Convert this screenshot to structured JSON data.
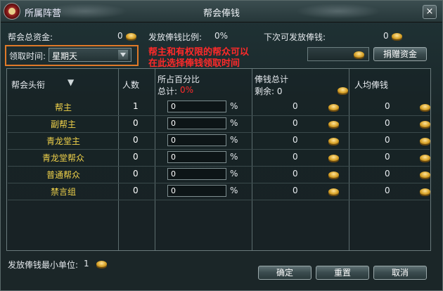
{
  "titlebar": {
    "faction": "所属阵营",
    "title": "帮会俸钱",
    "close": "×"
  },
  "top": {
    "total_funds_label": "帮会总资金:",
    "total_funds_value": "0",
    "ratio_label": "发放俸钱比例:",
    "ratio_value": "0%",
    "next_label": "下次可发放俸钱:",
    "next_value": "0"
  },
  "claim": {
    "label": "领取时间:",
    "value": "星期天"
  },
  "annotation": {
    "line1": "帮主和有权限的帮众可以",
    "line2": "在此选择俸钱领取时间"
  },
  "donate_button": "捐赠资金",
  "table": {
    "headers": {
      "rank": "帮会头衔",
      "count": "人数",
      "percent": "所占百分比",
      "total_label": "总计:",
      "total_value": "0%",
      "salary": "俸钱总计",
      "remaining": "剩余: 0",
      "avg": "人均俸钱"
    },
    "rows": [
      {
        "rank": "帮主",
        "count": "1",
        "pct": "0",
        "salary": "0",
        "avg": "0"
      },
      {
        "rank": "副帮主",
        "count": "0",
        "pct": "0",
        "salary": "0",
        "avg": "0"
      },
      {
        "rank": "青龙堂主",
        "count": "0",
        "pct": "0",
        "salary": "0",
        "avg": "0"
      },
      {
        "rank": "青龙堂帮众",
        "count": "0",
        "pct": "0",
        "salary": "0",
        "avg": "0"
      },
      {
        "rank": "普通帮众",
        "count": "0",
        "pct": "0",
        "salary": "0",
        "avg": "0"
      },
      {
        "rank": "禁言组",
        "count": "0",
        "pct": "0",
        "salary": "0",
        "avg": "0"
      }
    ],
    "percent_sign": "%"
  },
  "bottom": {
    "min_unit_label": "发放俸钱最小单位:",
    "min_unit_value": "1",
    "confirm": "确定",
    "reset": "重置",
    "cancel": "取消"
  },
  "colors": {
    "annotation": "#ff2a2a",
    "highlight": "#e07a28",
    "rank_text": "#f0d24a"
  }
}
